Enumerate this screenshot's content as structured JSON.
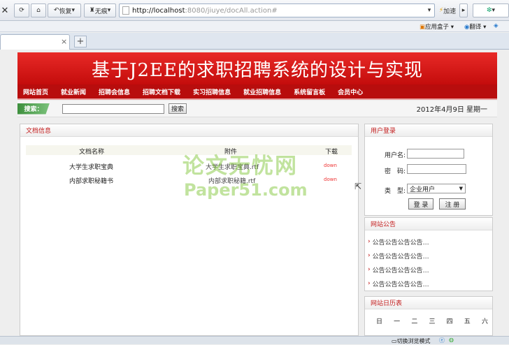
{
  "browser": {
    "back_label": "",
    "restore_label": "恢复",
    "noimg_label": "无痕",
    "url_host": "http://localhost",
    "url_rest": ":8080/jiuye/docAll.action#",
    "accel_label": "加速",
    "app_box_label": "应用盒子",
    "translate_label": "翻译",
    "tab_close": "×",
    "new_tab": "+",
    "status_text": "切换浏览模式"
  },
  "site": {
    "title": "基于J2EE的求职招聘系统的设计与实现",
    "nav": [
      "网站首页",
      "就业新闻",
      "招聘会信息",
      "招聘文档下载",
      "实习招聘信息",
      "就业招聘信息",
      "系统留言板",
      "会员中心"
    ],
    "search_label": "搜索：",
    "search_button": "搜索",
    "date": "2012年4月9日 星期一"
  },
  "docs": {
    "title": "文档信息",
    "headers": {
      "name": "文档名称",
      "file": "附件",
      "download": "下载"
    },
    "rows": [
      {
        "name": "大学生求职宝典",
        "file": "大学生求职宝典.rtf",
        "download": "down"
      },
      {
        "name": "内部求职秘籍书",
        "file": "内部求职秘籍.rtf",
        "download": "down"
      }
    ]
  },
  "watermark": {
    "line1": "论文无忧网",
    "line2": "Paper51.com"
  },
  "login": {
    "title": "用户登录",
    "user_label": "用户名:",
    "pass_label": "密　码:",
    "type_label": "类　型:",
    "type_value": "企业用户",
    "login_button": "登 录",
    "register_button": "注 册"
  },
  "notice": {
    "title": "网站公告",
    "items": [
      "公告公告公告公告…",
      "公告公告公告公告…",
      "公告公告公告公告…",
      "公告公告公告公告…"
    ]
  },
  "calendar": {
    "title": "网站日历表",
    "days": [
      "日",
      "一",
      "二",
      "三",
      "四",
      "五",
      "六"
    ]
  }
}
